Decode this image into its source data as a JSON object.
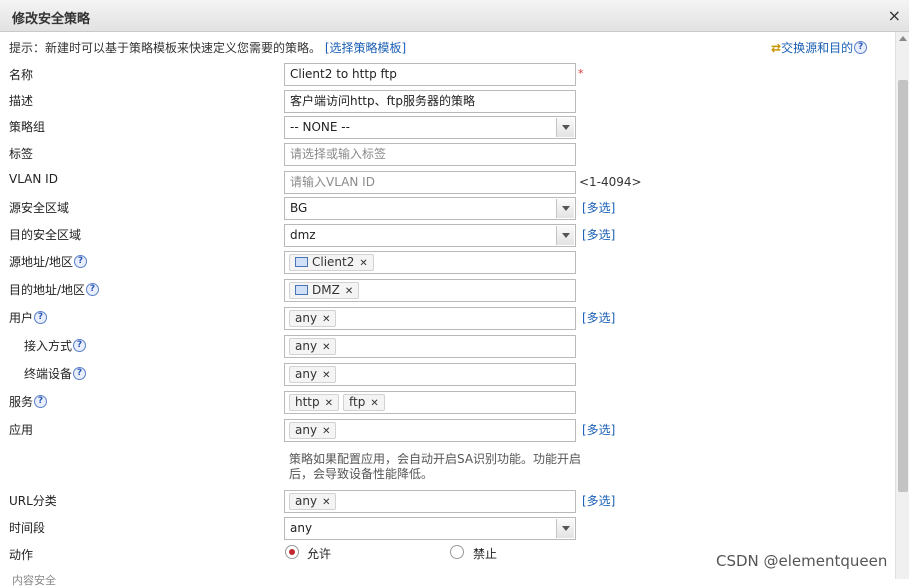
{
  "dialog": {
    "title": "修改安全策略",
    "close_icon": "×"
  },
  "hint": {
    "text": "提示：新建时可以基于策略模板来快速定义您需要的策略。",
    "link": "[选择策略模板]"
  },
  "swap": {
    "label": "交换源和目的",
    "icon": "swap-arrows-icon"
  },
  "labels": {
    "name": "名称",
    "description": "描述",
    "policy_group": "策略组",
    "tag": "标签",
    "vlan": "VLAN ID",
    "src_zone": "源安全区域",
    "dst_zone": "目的安全区域",
    "src_addr": "源地址/地区",
    "dst_addr": "目的地址/地区",
    "user": "用户",
    "access_method": "接入方式",
    "terminal": "终端设备",
    "service": "服务",
    "application": "应用",
    "url_category": "URL分类",
    "time_range": "时间段",
    "action": "动作"
  },
  "fields": {
    "name_value": "Client2 to http ftp",
    "required_mark": "*",
    "description_value": "客户端访问http、ftp服务器的策略",
    "policy_group_value": "-- NONE --",
    "tag_placeholder": "请选择或输入标签",
    "vlan_placeholder": "请输入VLAN ID",
    "vlan_range": "<1-4094>",
    "src_zone_value": "BG",
    "dst_zone_value": "dmz",
    "src_addr_tag": "Client2",
    "dst_addr_tag": "DMZ",
    "user_tag": "any",
    "access_method_tag": "any",
    "terminal_tag": "any",
    "service_tags": [
      "http",
      "ftp"
    ],
    "application_tag": "any",
    "url_category_tag": "any",
    "time_range_value": "any"
  },
  "multi_select_label": "[多选]",
  "help_icon": "?",
  "tag_remove": "✕",
  "app_note": "策略如果配置应用，会自动开启SA识别功能。功能开启后，会导致设备性能降低。",
  "action": {
    "options": [
      "允许",
      "禁止"
    ],
    "selected": "允许"
  },
  "cut_off_label": "内容安全",
  "watermark": "CSDN @elementqueen",
  "colors": {
    "link": "#1a5fb4",
    "required": "#dd3333",
    "radio_selected": "#c0282d"
  }
}
